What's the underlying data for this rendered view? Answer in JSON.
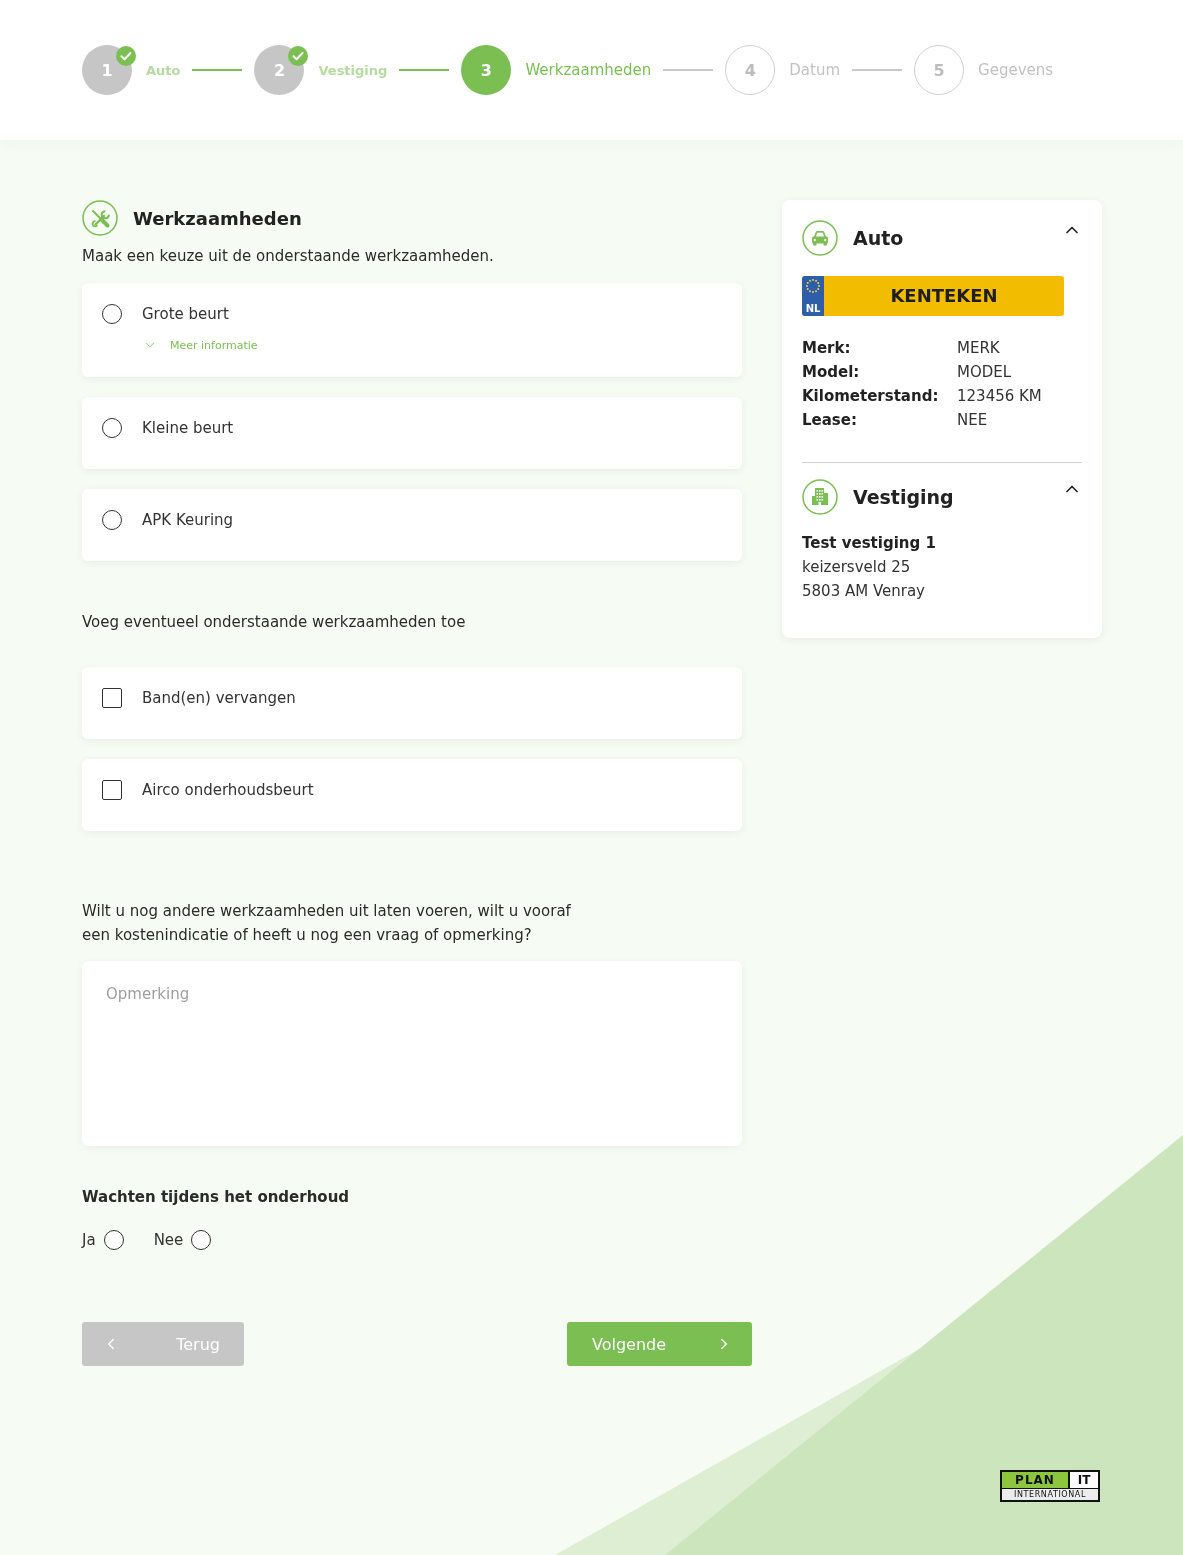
{
  "stepper": {
    "steps": [
      {
        "number": "1",
        "label": "Auto",
        "completed": true,
        "selected": false
      },
      {
        "number": "2",
        "label": "Vestiging",
        "completed": true,
        "selected": false
      },
      {
        "number": "3",
        "label": "Werkzaamheden",
        "completed": false,
        "selected": true
      },
      {
        "number": "4",
        "label": "Datum",
        "completed": false,
        "selected": false
      },
      {
        "number": "5",
        "label": "Gegevens",
        "completed": false,
        "selected": false
      }
    ]
  },
  "services": {
    "title": "Werkzaamheden",
    "subtitle": "Maak een keuze uit de onderstaande werkzaamheden.",
    "options": [
      {
        "label": "Grote beurt",
        "selected": false,
        "more_info": "Meer informatie"
      },
      {
        "label": "Kleine beurt",
        "selected": false
      },
      {
        "label": "APK Keuring",
        "selected": false
      }
    ]
  },
  "extras": {
    "heading": "Voeg eventueel onderstaande werkzaamheden toe",
    "options": [
      {
        "label": "Band(en) vervangen",
        "checked": false
      },
      {
        "label": "Airco onderhoudsbeurt",
        "checked": false
      }
    ]
  },
  "remarks": {
    "question": "Wilt u nog andere werkzaamheden uit laten voeren, wilt u vooraf een kostenindicatie of heeft u nog een vraag of opmerking?",
    "placeholder": "Opmerking"
  },
  "waiting": {
    "title": "Wachten tijdens het onderhoud",
    "options": [
      {
        "label": "Ja",
        "selected": false
      },
      {
        "label": "Nee",
        "selected": false
      }
    ]
  },
  "buttons": {
    "back": "Terug",
    "next": "Volgende"
  },
  "summary": {
    "auto": {
      "title": "Auto",
      "expanded": true,
      "plate": {
        "country": "NL",
        "text": "KENTEKEN"
      },
      "details": [
        {
          "label": "Merk:",
          "value": "MERK"
        },
        {
          "label": "Model:",
          "value": "MODEL"
        },
        {
          "label": "Kilometerstand:",
          "value": "123456 KM"
        },
        {
          "label": "Lease:",
          "value": "NEE"
        }
      ]
    },
    "vestiging": {
      "title": "Vestiging",
      "expanded": true,
      "name": "Test vestiging 1",
      "lines": [
        "keizersveld 25",
        "5803 AM Venray"
      ]
    }
  },
  "logo": {
    "name": "PLAN",
    "suffix": "IT",
    "tagline": "INTERNATIONAL"
  }
}
